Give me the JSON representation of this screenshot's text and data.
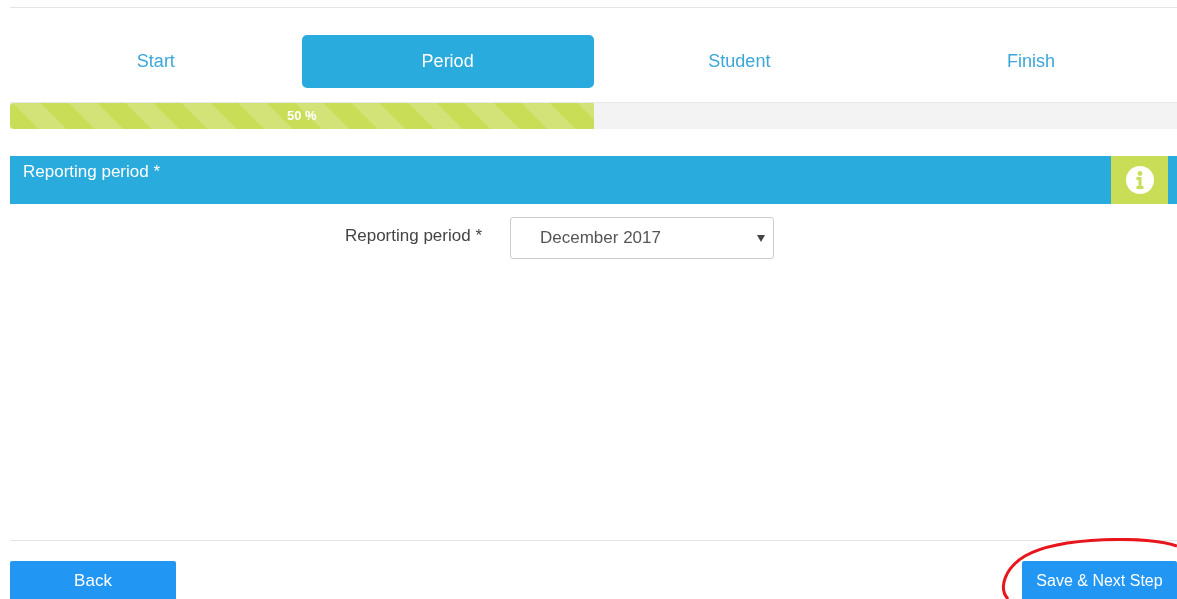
{
  "steps": [
    {
      "label": "Start",
      "selected": false
    },
    {
      "label": "Period",
      "selected": true
    },
    {
      "label": "Student",
      "selected": false
    },
    {
      "label": "Finish",
      "selected": false
    }
  ],
  "progress": {
    "level": 0.5,
    "reading": "50 %"
  },
  "section": {
    "title": "Reporting period *"
  },
  "field": {
    "label": "Reporting period *",
    "value": "December 2017"
  },
  "buttons": {
    "back": "Back",
    "next": "Save & Next Step"
  }
}
